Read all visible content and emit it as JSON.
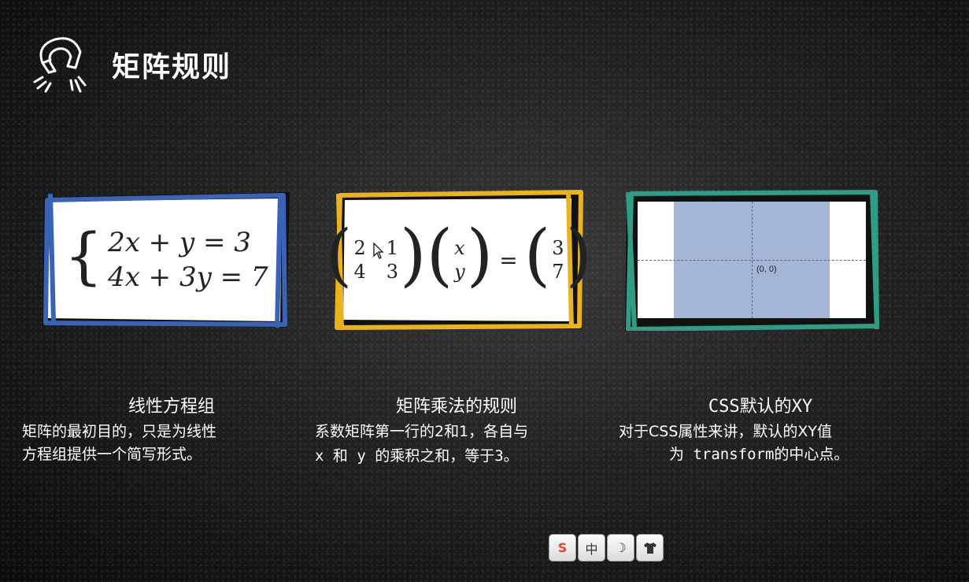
{
  "page": {
    "title": "矩阵规则"
  },
  "cards": {
    "equation": {
      "line1": "2x + y = 3",
      "line2": "4x + 3y = 7",
      "color": "#3a63b8"
    },
    "matrix": {
      "a": [
        "2",
        "1",
        "4",
        "3"
      ],
      "vars": [
        "x",
        "y"
      ],
      "result": [
        "3",
        "7"
      ],
      "equals": "=",
      "color": "#e8b321"
    },
    "css": {
      "origin_label": "(0, 0)",
      "color": "#2f9d86",
      "box_color": "#a4b6d8"
    }
  },
  "captions": [
    {
      "title": "线性方程组",
      "line1": "矩阵的最初目的，只是为线性",
      "line2": "方程组提供一个简写形式。"
    },
    {
      "title": "矩阵乘法的规则",
      "line1": "系数矩阵第一行的2和1，各自与",
      "line2": "x 和 y 的乘积之和，等于3。"
    },
    {
      "title": "CSS默认的XY",
      "line1": "对于CSS属性来讲，默认的XY值",
      "line2": "为 transform的中心点。"
    }
  ],
  "toolbar": {
    "sogou": "S",
    "lang": "中",
    "moon": "☽",
    "shirt": "👕"
  }
}
